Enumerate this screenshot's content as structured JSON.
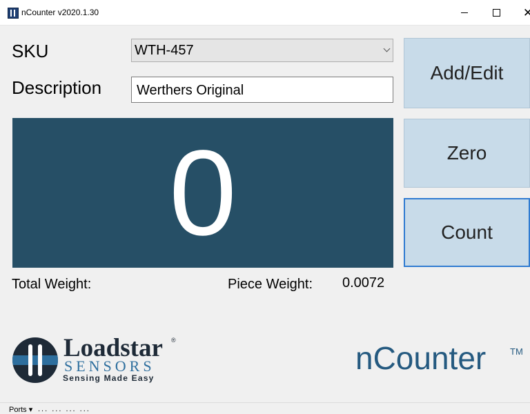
{
  "window": {
    "title": "nCounter v2020.1.30",
    "minimize": "—",
    "close": "✕"
  },
  "form": {
    "sku_label": "SKU",
    "sku_value": "WTH-457",
    "description_label": "Description",
    "description_value": "Werthers Original"
  },
  "counter": {
    "display": "0"
  },
  "buttons": {
    "add_edit": "Add/Edit",
    "zero": "Zero",
    "count": "Count"
  },
  "weights": {
    "total_label": "Total Weight:",
    "piece_label": "Piece Weight:",
    "piece_value": "0.0072"
  },
  "logo": {
    "name": "Loadstar",
    "registered": "®",
    "sensors": "SENSORS",
    "tagline": "Sensing Made Easy"
  },
  "brand": {
    "name": "nCounter",
    "tm": "TM"
  },
  "status": {
    "ports": "Ports ▾",
    "dots": "... ... ... ..."
  },
  "colors": {
    "panel": "#264f66",
    "button": "#c8dbe9",
    "focus_border": "#2f7bd1",
    "brand": "#255a80"
  }
}
